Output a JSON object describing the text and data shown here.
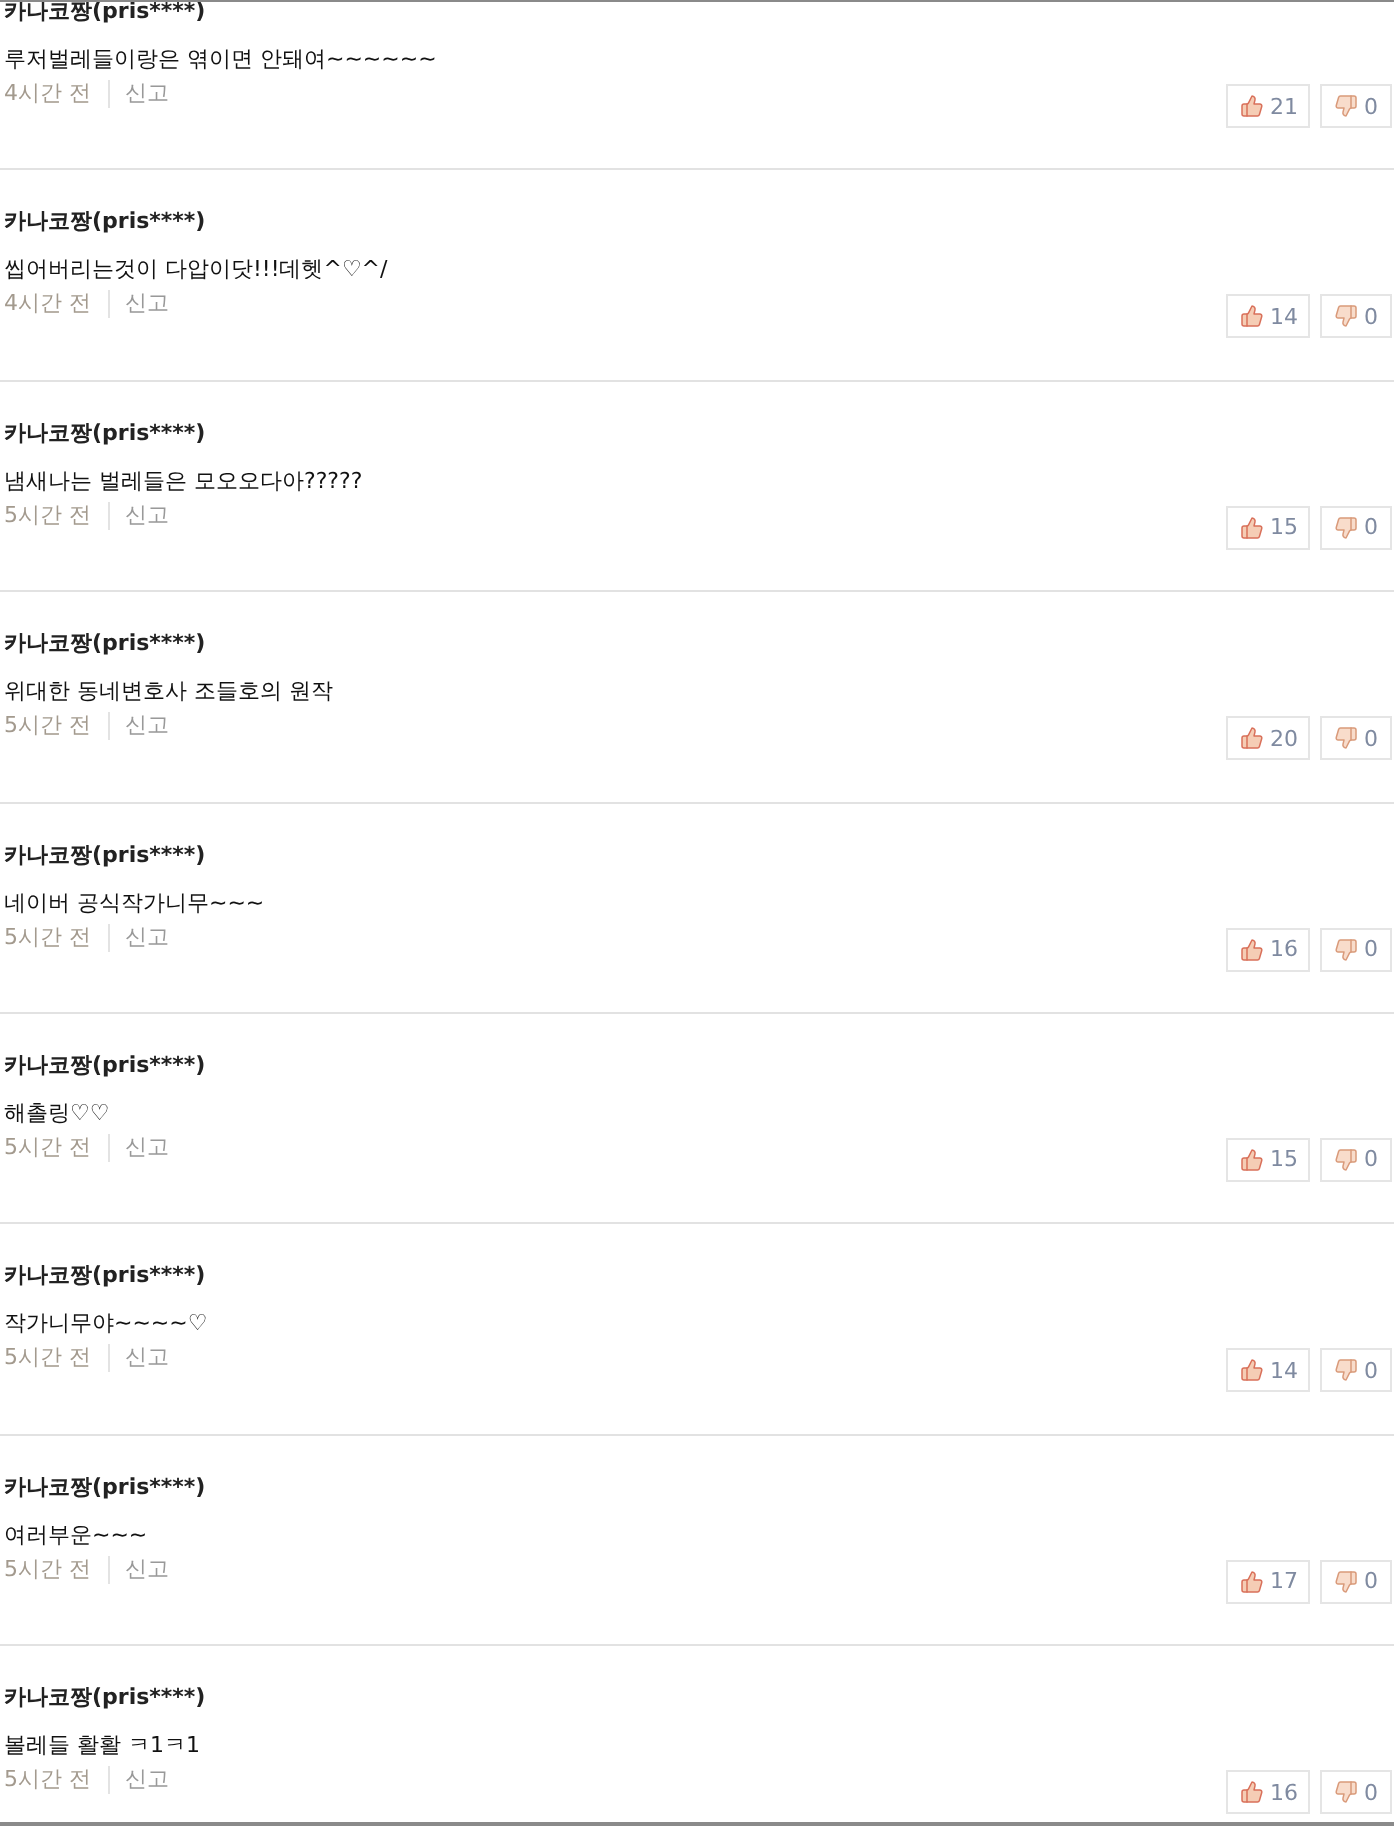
{
  "comments": [
    {
      "author": "카나코짱(pris****)",
      "text": "루저벌레들이랑은 엮이면 안돼여~~~~~~",
      "time": "4시간 전",
      "report": "신고",
      "likes": "21",
      "dislikes": "0"
    },
    {
      "author": "카나코짱(pris****)",
      "text": "씹어버리는것이 다압이닷!!!데헷^♡^/",
      "time": "4시간 전",
      "report": "신고",
      "likes": "14",
      "dislikes": "0"
    },
    {
      "author": "카나코짱(pris****)",
      "text": "냄새나는 벌레들은 모오오다아?????",
      "time": "5시간 전",
      "report": "신고",
      "likes": "15",
      "dislikes": "0"
    },
    {
      "author": "카나코짱(pris****)",
      "text": "위대한 동네변호사 조들호의 원작",
      "time": "5시간 전",
      "report": "신고",
      "likes": "20",
      "dislikes": "0"
    },
    {
      "author": "카나코짱(pris****)",
      "text": "네이버 공식작가니무~~~",
      "time": "5시간 전",
      "report": "신고",
      "likes": "16",
      "dislikes": "0"
    },
    {
      "author": "카나코짱(pris****)",
      "text": "해촐링♡♡",
      "time": "5시간 전",
      "report": "신고",
      "likes": "15",
      "dislikes": "0"
    },
    {
      "author": "카나코짱(pris****)",
      "text": "작가니무야~~~~♡",
      "time": "5시간 전",
      "report": "신고",
      "likes": "14",
      "dislikes": "0"
    },
    {
      "author": "카나코짱(pris****)",
      "text": "여러부운~~~",
      "time": "5시간 전",
      "report": "신고",
      "likes": "17",
      "dislikes": "0"
    },
    {
      "author": "카나코짱(pris****)",
      "text": "볼레들 활활 ㅋ1ㅋ1",
      "time": "5시간 전",
      "report": "신고",
      "likes": "16",
      "dislikes": "0"
    }
  ]
}
